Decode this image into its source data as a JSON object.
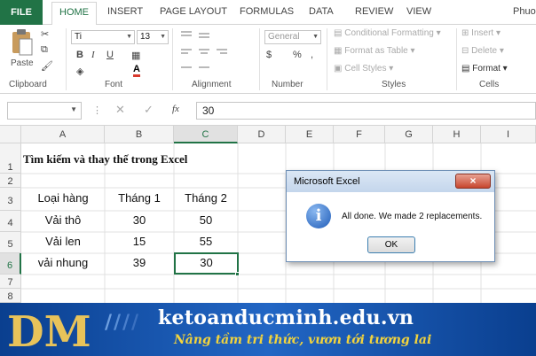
{
  "ribbon": {
    "tabs": [
      "FILE",
      "HOME",
      "INSERT",
      "PAGE LAYOUT",
      "FORMULAS",
      "DATA",
      "REVIEW",
      "VIEW"
    ],
    "user": "Phuo",
    "clipboard": {
      "paste": "Paste",
      "label": "Clipboard"
    },
    "font": {
      "name": "Ti",
      "size": "13",
      "label": "Font",
      "bold": "B",
      "italic": "I",
      "underline": "U"
    },
    "alignment": {
      "label": "Alignment"
    },
    "number": {
      "format": "General",
      "percent": "%",
      "comma": ",",
      "label": "Number"
    },
    "styles": {
      "conditional_formatting": "Conditional Formatting",
      "format_as_table": "Format as Table",
      "cell_styles": "Cell Styles",
      "label": "Styles"
    },
    "cells": {
      "insert": "Insert",
      "delete": "Delete",
      "format": "Format",
      "label": "Cells"
    }
  },
  "formula_bar": {
    "fx": "fx",
    "value": "30"
  },
  "grid": {
    "columns": [
      "A",
      "B",
      "C",
      "D",
      "E",
      "F",
      "G",
      "H",
      "I"
    ],
    "rows": [
      "1",
      "2",
      "3",
      "4",
      "5",
      "6",
      "7",
      "8"
    ],
    "title": "Tìm kiếm và thay thế trong Excel",
    "headers": [
      "Loại hàng",
      "Tháng 1",
      "Tháng 2"
    ],
    "data": [
      [
        "Vải thô",
        "30",
        "50"
      ],
      [
        "Vải len",
        "15",
        "55"
      ],
      [
        "vải nhung",
        "39",
        "30"
      ]
    ]
  },
  "dialog": {
    "title": "Microsoft Excel",
    "close": "×",
    "icon": "i",
    "message": "All done. We made 2 replacements.",
    "ok": "OK"
  },
  "banner": {
    "logo": "DM",
    "site": "ketoanducminh.edu.vn",
    "slogan": "Nâng tầm tri thức, vươn tới tương lai"
  },
  "colors": {
    "excel_green": "#217346",
    "banner_blue": "#1a56b5",
    "slogan_gold": "#f2d33d"
  }
}
